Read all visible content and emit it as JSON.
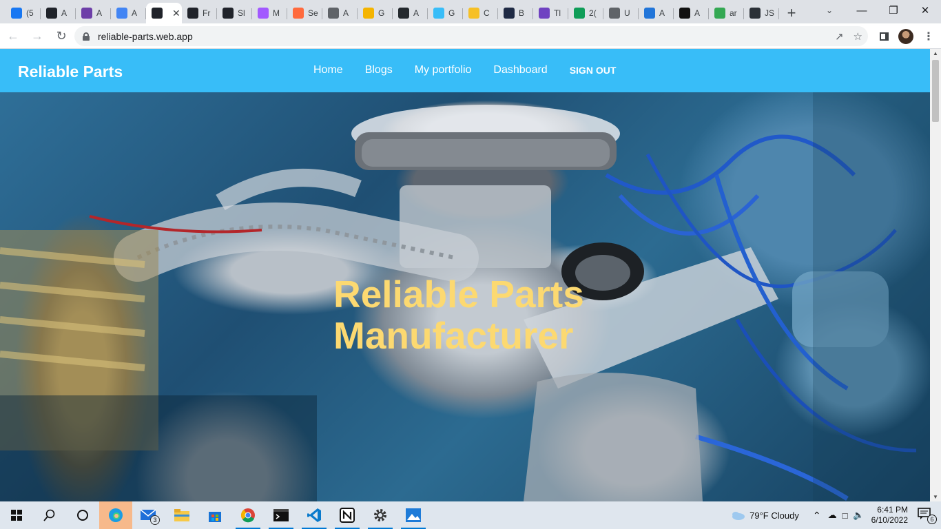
{
  "browser": {
    "tabs": [
      {
        "label": "(5",
        "icon": "facebook-icon",
        "color": "#1877f2"
      },
      {
        "label": "A",
        "icon": "react-icon",
        "color": "#20232a"
      },
      {
        "label": "A",
        "icon": "person-icon",
        "color": "#6d3fa8"
      },
      {
        "label": "A",
        "icon": "docs-icon",
        "color": "#4285f4"
      },
      {
        "label": "",
        "icon": "react-icon",
        "color": "#20232a",
        "active": true
      },
      {
        "label": "Fr",
        "icon": "react-icon",
        "color": "#20232a"
      },
      {
        "label": "Sl",
        "icon": "react-icon",
        "color": "#20232a"
      },
      {
        "label": "M",
        "icon": "figma-icon",
        "color": "#a259ff"
      },
      {
        "label": "Se",
        "icon": "circle-icon",
        "color": "#ff6a3d"
      },
      {
        "label": "A",
        "icon": "globe-icon",
        "color": "#5f6368"
      },
      {
        "label": "G",
        "icon": "hand-icon",
        "color": "#f4b400"
      },
      {
        "label": "A",
        "icon": "github-icon",
        "color": "#24292e"
      },
      {
        "label": "G",
        "icon": "tailwind-icon",
        "color": "#38bdf8"
      },
      {
        "label": "C",
        "icon": "sun-icon",
        "color": "#f6c026"
      },
      {
        "label": "B",
        "icon": "bootstrap-icon",
        "color": "#1f2a44"
      },
      {
        "label": "Tl",
        "icon": "six-icon",
        "color": "#6f42c1"
      },
      {
        "label": "2(",
        "icon": "grid-icon",
        "color": "#0f9d58"
      },
      {
        "label": "U",
        "icon": "layers-icon",
        "color": "#5f6368"
      },
      {
        "label": "A",
        "icon": "ibb-icon",
        "color": "#2175d9"
      },
      {
        "label": "A",
        "icon": "box-icon",
        "color": "#111111"
      },
      {
        "label": "ar",
        "icon": "drive-icon",
        "color": "#34a853"
      },
      {
        "label": "JS",
        "icon": "js-icon",
        "color": "#2b3137"
      }
    ],
    "url": "reliable-parts.web.app"
  },
  "site": {
    "brand": "Reliable Parts",
    "nav": [
      "Home",
      "Blogs",
      "My portfolio",
      "Dashboard"
    ],
    "signout": "SIGN OUT",
    "hero_title": "Reliable Parts Manufacturer",
    "colors": {
      "navbar": "#38bdf8",
      "hero_text": "#fcd971"
    }
  },
  "taskbar": {
    "mail_badge": "3",
    "weather": "79°F  Cloudy",
    "time": "6:41 PM",
    "date": "6/10/2022",
    "notifications": "6"
  }
}
